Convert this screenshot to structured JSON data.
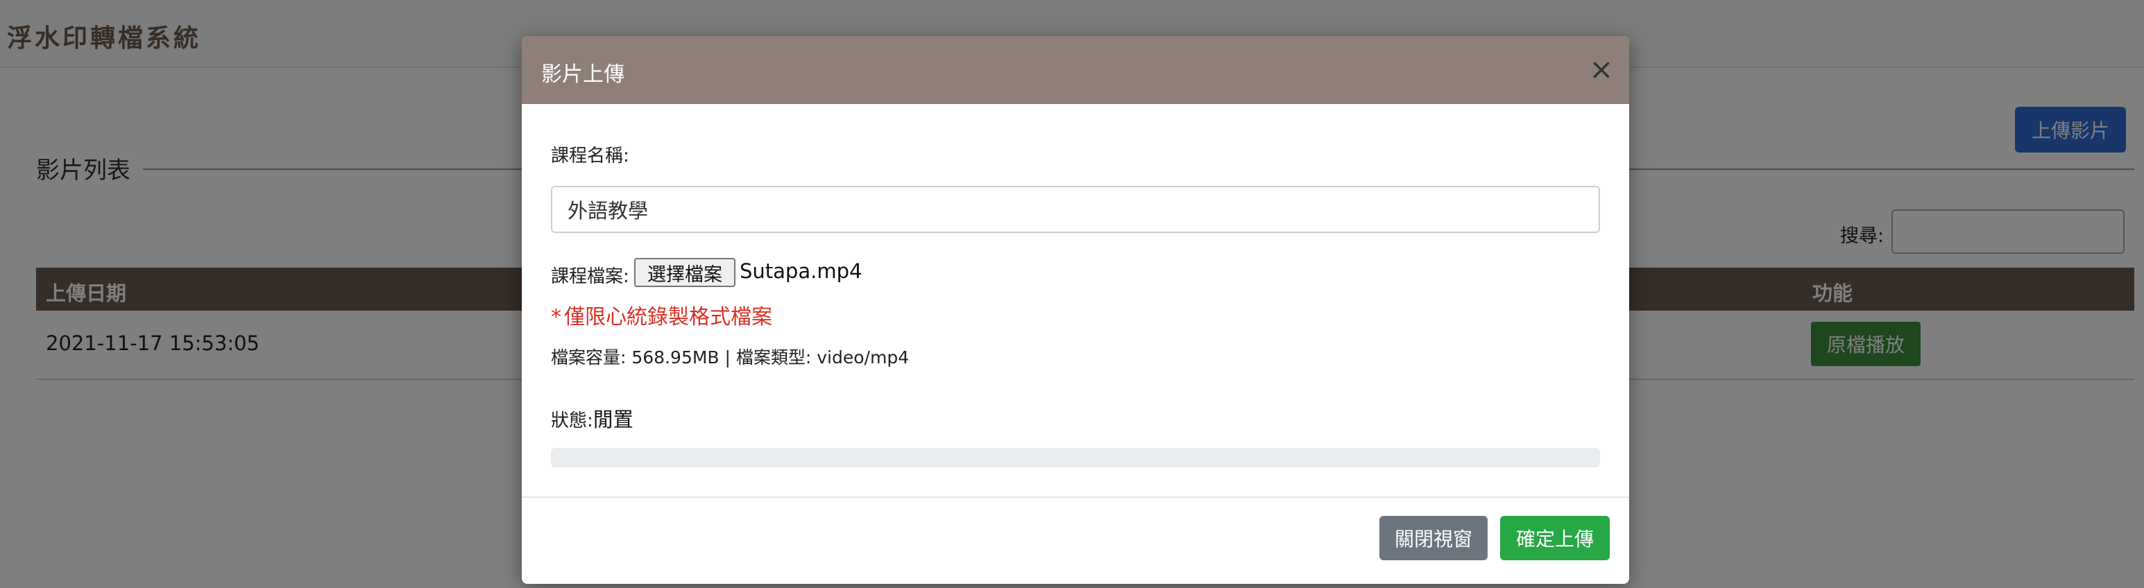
{
  "app": {
    "title": "浮水印轉檔系統"
  },
  "page": {
    "upload_button": "上傳影片",
    "section_title": "影片列表",
    "search_label": "搜尋:",
    "search_value": "",
    "table": {
      "headers": [
        "上傳日期",
        "功能"
      ],
      "rows": [
        {
          "upload_date": "2021-11-17 15:53:05",
          "action": "原檔播放"
        }
      ]
    }
  },
  "modal": {
    "title": "影片上傳",
    "close_symbol": "×",
    "course_name_label": "課程名稱:",
    "course_name_value": "外語教學",
    "course_file_label": "課程檔案:",
    "choose_file_label": "選擇檔案",
    "file_name": "Sutapa.mp4",
    "warning_star": "*",
    "warning_text": "僅限心統錄製格式檔案",
    "file_meta": "檔案容量: 568.95MB | 檔案類型: video/mp4",
    "status_label": "狀態:",
    "status_value": "閒置",
    "progress_percent": 0,
    "close_window_label": "關閉視窗",
    "confirm_label": "確定上傳"
  },
  "colors": {
    "brand_brown": "#6b5a4e",
    "modal_header": "#8f7f79",
    "primary_blue": "#2f6fd6",
    "success_green": "#28a745",
    "warning_red": "#d93025"
  }
}
